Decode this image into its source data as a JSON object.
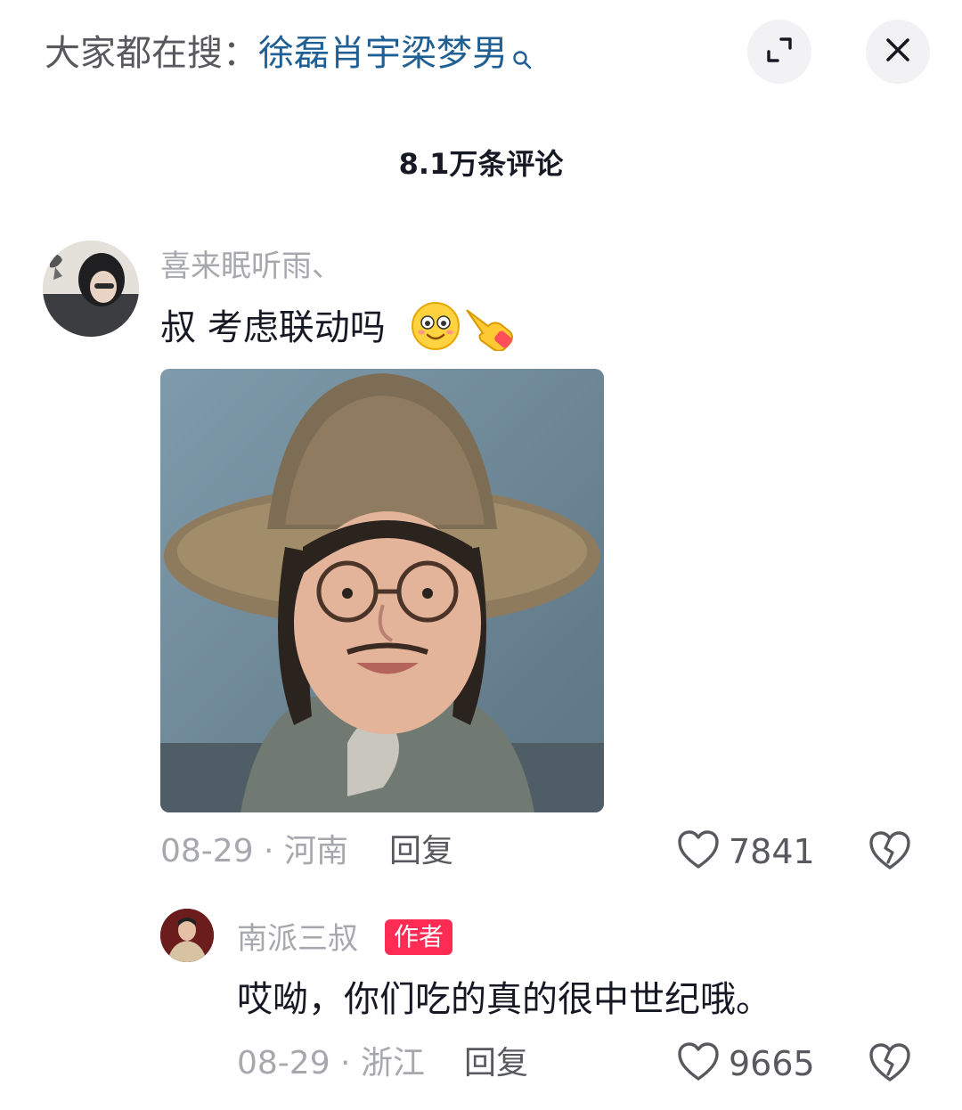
{
  "search_bar": {
    "prefix": "大家都在搜：",
    "keyword": "徐磊肖宇梁梦男",
    "icon": "search-icon"
  },
  "header": {
    "comments_count": "8.1万条评论",
    "expand_icon": "expand-icon",
    "close_icon": "close-icon"
  },
  "comments": [
    {
      "username": "喜来眠听雨、",
      "text": "叔 考虑联动吗",
      "emojis": [
        "smile-emoji",
        "pointing-hand-emoji"
      ],
      "image": "straw-hat-character-meme",
      "date_location": "08-29 · 河南",
      "reply_label": "回复",
      "likes": "7841"
    },
    {
      "username": "南派三叔",
      "badge": "作者",
      "text": "哎呦，你们吃的真的很中世纪哦。",
      "date_location": "08-29 · 浙江",
      "reply_label": "回复",
      "likes": "9665"
    }
  ],
  "colors": {
    "keyword_blue": "#1f5f94",
    "badge_red": "#fe2c55",
    "muted_gray": "#a7a8ad"
  }
}
